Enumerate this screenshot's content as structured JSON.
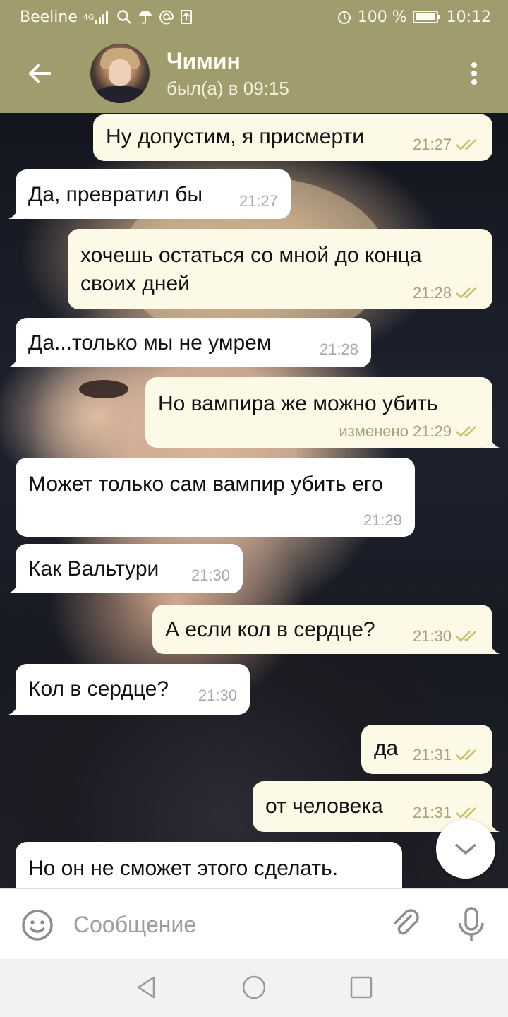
{
  "status_bar": {
    "carrier": "Beeline",
    "network": "4G",
    "battery": "100 %",
    "time": "10:12",
    "icons": [
      "signal-icon",
      "search-icon",
      "umbrella-icon",
      "at-icon",
      "upload-icon",
      "alarm-icon",
      "battery-icon"
    ]
  },
  "header": {
    "contact_name": "Чимин",
    "contact_status": "был(а) в 09:15",
    "icons": [
      "back-arrow-icon",
      "avatar",
      "more-vert-icon"
    ]
  },
  "messages": [
    {
      "direction": "out",
      "text": "Ну допустим, я присмерти",
      "time": "21:27",
      "edited": "",
      "read": true
    },
    {
      "direction": "in",
      "text": "Да, превратил бы",
      "time": "21:27",
      "edited": ""
    },
    {
      "direction": "out",
      "text": "хочешь остаться со мной до конца своих дней",
      "time": "21:28",
      "edited": "",
      "read": true
    },
    {
      "direction": "in",
      "text": "Да...только мы не умрем",
      "time": "21:28",
      "edited": ""
    },
    {
      "direction": "out",
      "text": "Но вампира же можно убить",
      "time": "21:29",
      "edited": "изменено",
      "read": true
    },
    {
      "direction": "in",
      "text": "Может только сам вампир убить его",
      "time": "21:29",
      "edited": ""
    },
    {
      "direction": "in",
      "text": "Как Вальтури",
      "time": "21:30",
      "edited": ""
    },
    {
      "direction": "out",
      "text": "А если кол в сердце?",
      "time": "21:30",
      "edited": "",
      "read": true
    },
    {
      "direction": "in",
      "text": "Кол в сердце?",
      "time": "21:30",
      "edited": ""
    },
    {
      "direction": "out",
      "text": "да",
      "time": "21:31",
      "edited": "",
      "read": true
    },
    {
      "direction": "out",
      "text": "от человека",
      "time": "21:31",
      "edited": "",
      "read": true
    },
    {
      "direction": "in",
      "text": "Но он не сможет этого сделать.",
      "time": "",
      "edited": ""
    }
  ],
  "composer": {
    "placeholder": "Сообщение",
    "icons": [
      "emoji-icon",
      "attach-icon",
      "mic-icon"
    ]
  },
  "scroll_button": {
    "icon": "chevron-down-icon"
  },
  "nav_bar": {
    "icons": [
      "nav-back-icon",
      "nav-home-icon",
      "nav-recent-icon"
    ]
  },
  "colors": {
    "header_bg": "#a09c6e",
    "outgoing_bubble": "#fcf9e6",
    "incoming_bubble": "#ffffff",
    "check_color": "#c9bf6a",
    "time_color": "#a7a27c"
  }
}
